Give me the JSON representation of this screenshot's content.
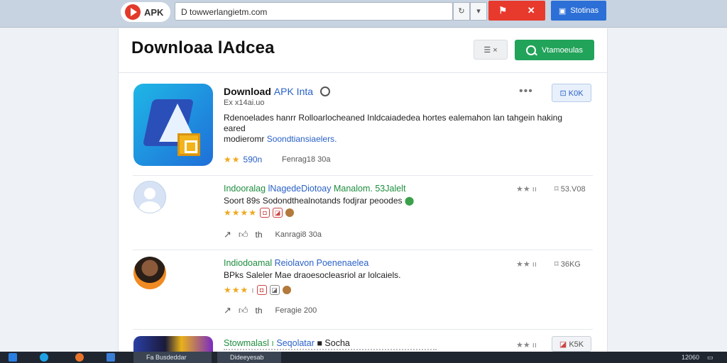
{
  "browser": {
    "logo_text": "APK",
    "url": "D towwerlangietm.com",
    "red_button_icons": [
      "flag-icon",
      "puzzle-icon"
    ],
    "blue_button_label": "Stotinas"
  },
  "header": {
    "title": "Downloaa lAdcea",
    "filter_label": "☰ ×",
    "search_label": "Vtamoeulas"
  },
  "featured": {
    "title_bold": "Download ",
    "title_blue": "APK Inta",
    "subtitle": "Ex   x14ai.uo",
    "description_line1": "Rdenoelades hanrr Rolloarlocheaned Inldcaiadedea hortes ealemahon lan tahgein haking eared",
    "description_line2_prefix": "modieromr ",
    "description_line2_blue": "Soondtiansiaelers.",
    "rating_stars": "★★",
    "rating_count": "590n",
    "downloads": "Fenrag18 30a",
    "menu": "•••",
    "action_label": "K0K"
  },
  "items": [
    {
      "title_green": "Indooralag",
      "title_blue": "lNagedeDiotoay",
      "title_rest": " Manalom. 53Jalelt",
      "description": "Soort 89s Sodondthealnotands fodjrar peoodes",
      "rating_stars": "★★★★",
      "actions_count": "th",
      "downloads": "Kanragi8 30a",
      "meta": "★★ ıı",
      "side": "53.V08"
    },
    {
      "title_green": "Indiodoamal",
      "title_blue": " Reiolavon Poenenaelea",
      "title_rest": "",
      "description": "BPks Saleler Mae draoesocleasriol ar lolcaiels.",
      "rating_stars": "★★★",
      "actions_count": "th",
      "downloads": "Feragie 200",
      "meta": "★★ ıı",
      "side": "36KG"
    },
    {
      "title_green": "Stowmalasl",
      "title_blue": "Seqolatar",
      "title_rest": " Socha",
      "description": "",
      "rating_stars": "",
      "actions_count": "",
      "downloads": "",
      "meta": "★★ ıı",
      "side": "K5K"
    }
  ],
  "taskbar": {
    "apps": [
      "Fa",
      "Busdeddar",
      "Dideeyesab"
    ],
    "clock": "12060"
  }
}
